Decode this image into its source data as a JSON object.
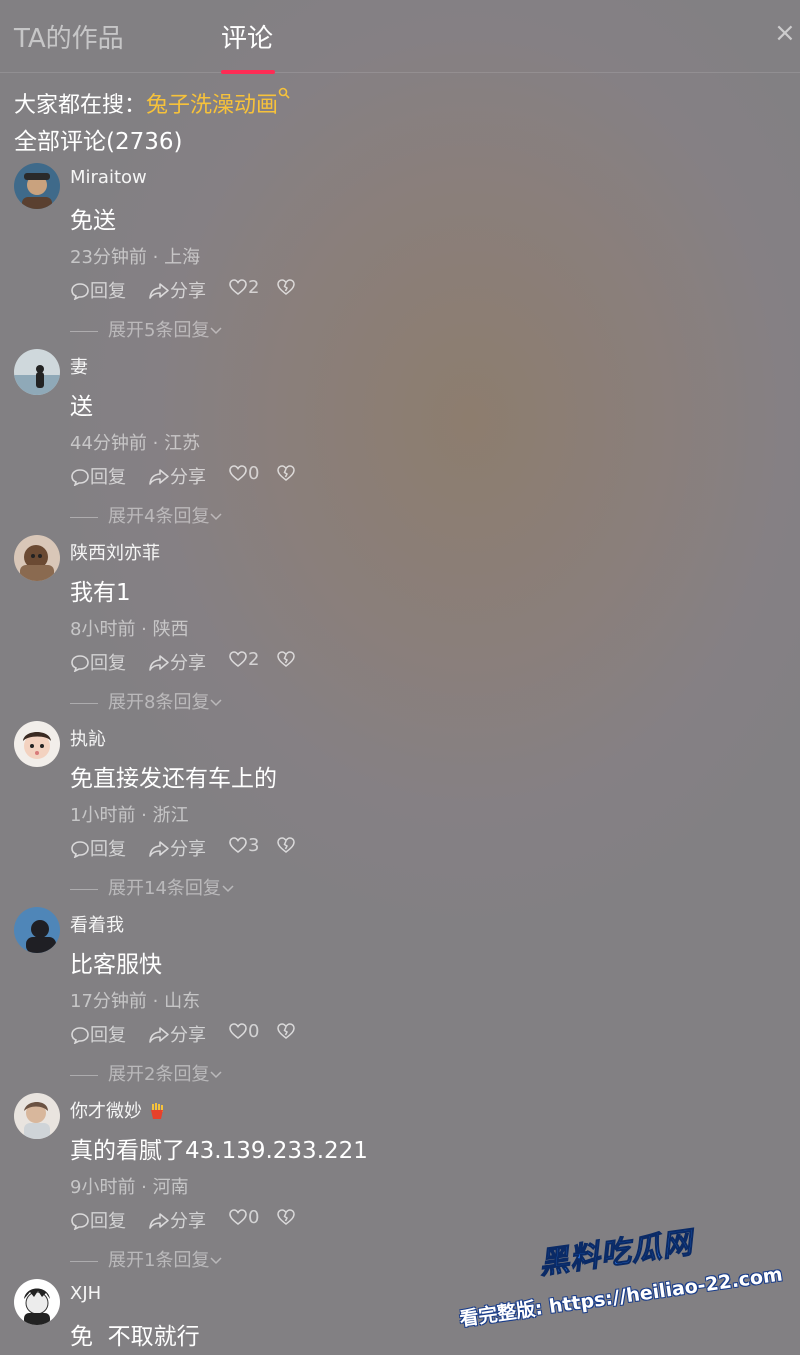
{
  "tabs": {
    "works_label": "TA的作品",
    "comments_label": "评论",
    "close_glyph": "×"
  },
  "hot_search": {
    "prefix": "大家都在搜：",
    "keyword": "兔子洗澡动画"
  },
  "total_label": "全部评论(2736)",
  "actions": {
    "reply": "回复",
    "share": "分享"
  },
  "comments": [
    {
      "user": "Miraitow",
      "text": "免送",
      "meta": "23分钟前 · 上海",
      "likes": "2",
      "expand": "展开5条回复"
    },
    {
      "user": "妻",
      "text": "送",
      "meta": "44分钟前 · 江苏",
      "likes": "0",
      "expand": "展开4条回复"
    },
    {
      "user": "陕西刘亦菲",
      "text": "我有1",
      "meta": "8小时前 · 陕西",
      "likes": "2",
      "expand": "展开8条回复"
    },
    {
      "user": "执訫",
      "text": "免直接发还有车上的",
      "meta": "1小时前 · 浙江",
      "likes": "3",
      "expand": "展开14条回复"
    },
    {
      "user": "看着我",
      "text": "比客服快",
      "meta": "17分钟前 · 山东",
      "likes": "0",
      "expand": "展开2条回复"
    },
    {
      "user": "你才微妙",
      "text": "真的看腻了43.139.233.221",
      "meta": "9小时前 · 河南",
      "likes": "0",
      "expand": "展开1条回复"
    },
    {
      "user": "XJH",
      "text": "免  不取就行"
    }
  ],
  "watermark": {
    "logo": "黑料吃瓜网",
    "url_text": "看完整版: https://heiliao-22.com"
  },
  "colors": {
    "accent": "#fe2c55",
    "keyword": "#f7c23a"
  }
}
